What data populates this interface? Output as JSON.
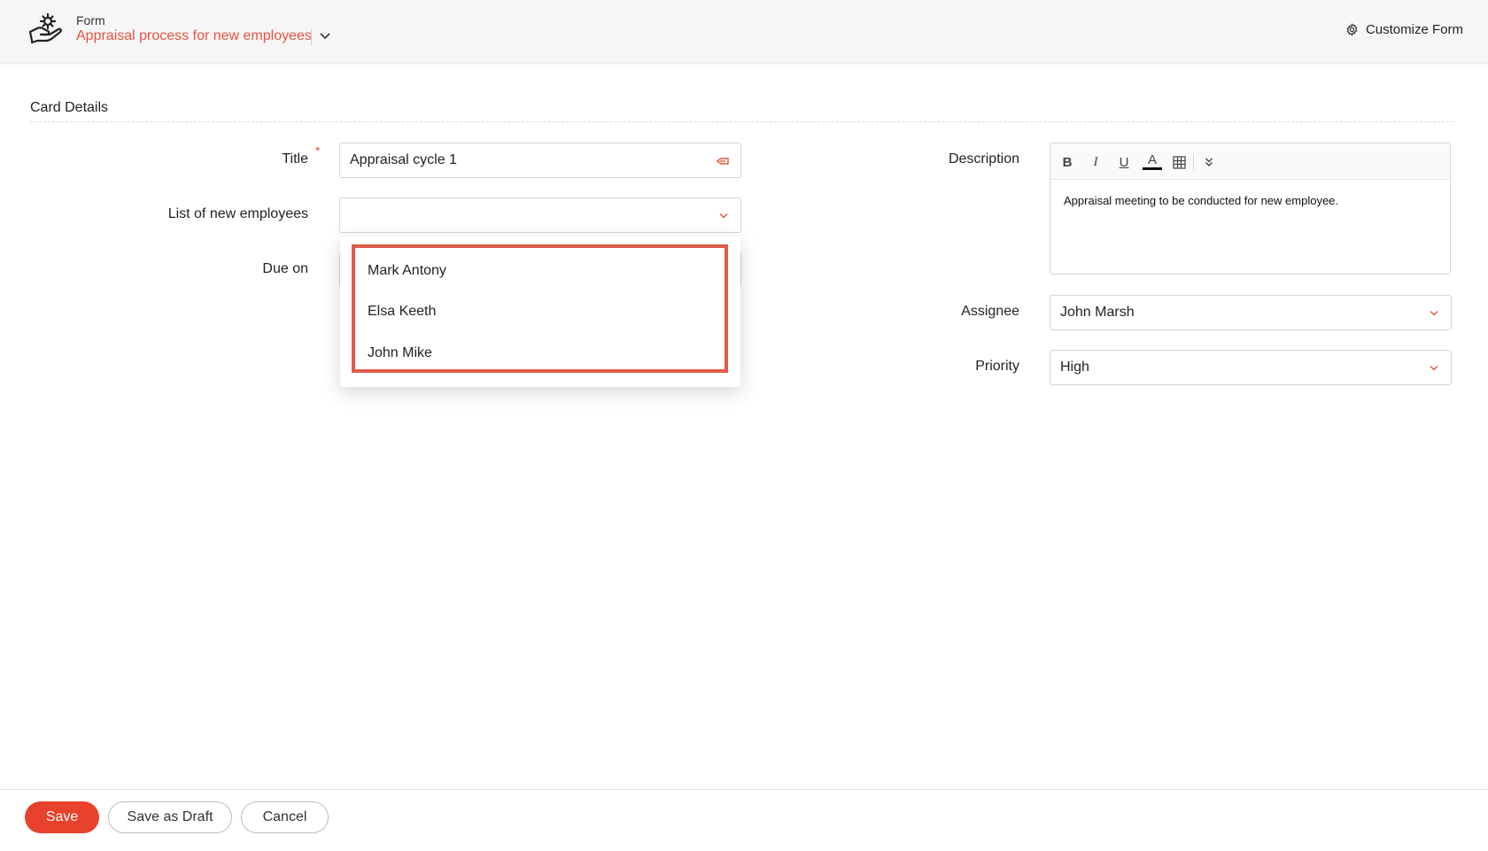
{
  "header": {
    "form_label": "Form",
    "form_name": "Appraisal process for new employees",
    "customize_label": "Customize Form"
  },
  "section": {
    "title": "Card Details"
  },
  "fields": {
    "title": {
      "label": "Title",
      "required_mark": "*",
      "value": "Appraisal cycle 1"
    },
    "employees": {
      "label": "List of new employees",
      "value": "",
      "options": [
        "Mark Antony",
        "Elsa Keeth",
        "John Mike"
      ]
    },
    "due_on": {
      "label": "Due on",
      "value": ""
    },
    "description": {
      "label": "Description",
      "toolbar": {
        "bold": "B",
        "italic": "I",
        "underline": "U",
        "font_color": "A"
      },
      "value": "Appraisal meeting to be conducted for new employee."
    },
    "assignee": {
      "label": "Assignee",
      "value": "John Marsh"
    },
    "priority": {
      "label": "Priority",
      "value": "High"
    }
  },
  "footer": {
    "save_label": "Save",
    "draft_label": "Save as Draft",
    "cancel_label": "Cancel"
  },
  "colors": {
    "accent": "#e8533d",
    "save_button": "#e8412c",
    "highlight_border": "#e05a4a"
  }
}
